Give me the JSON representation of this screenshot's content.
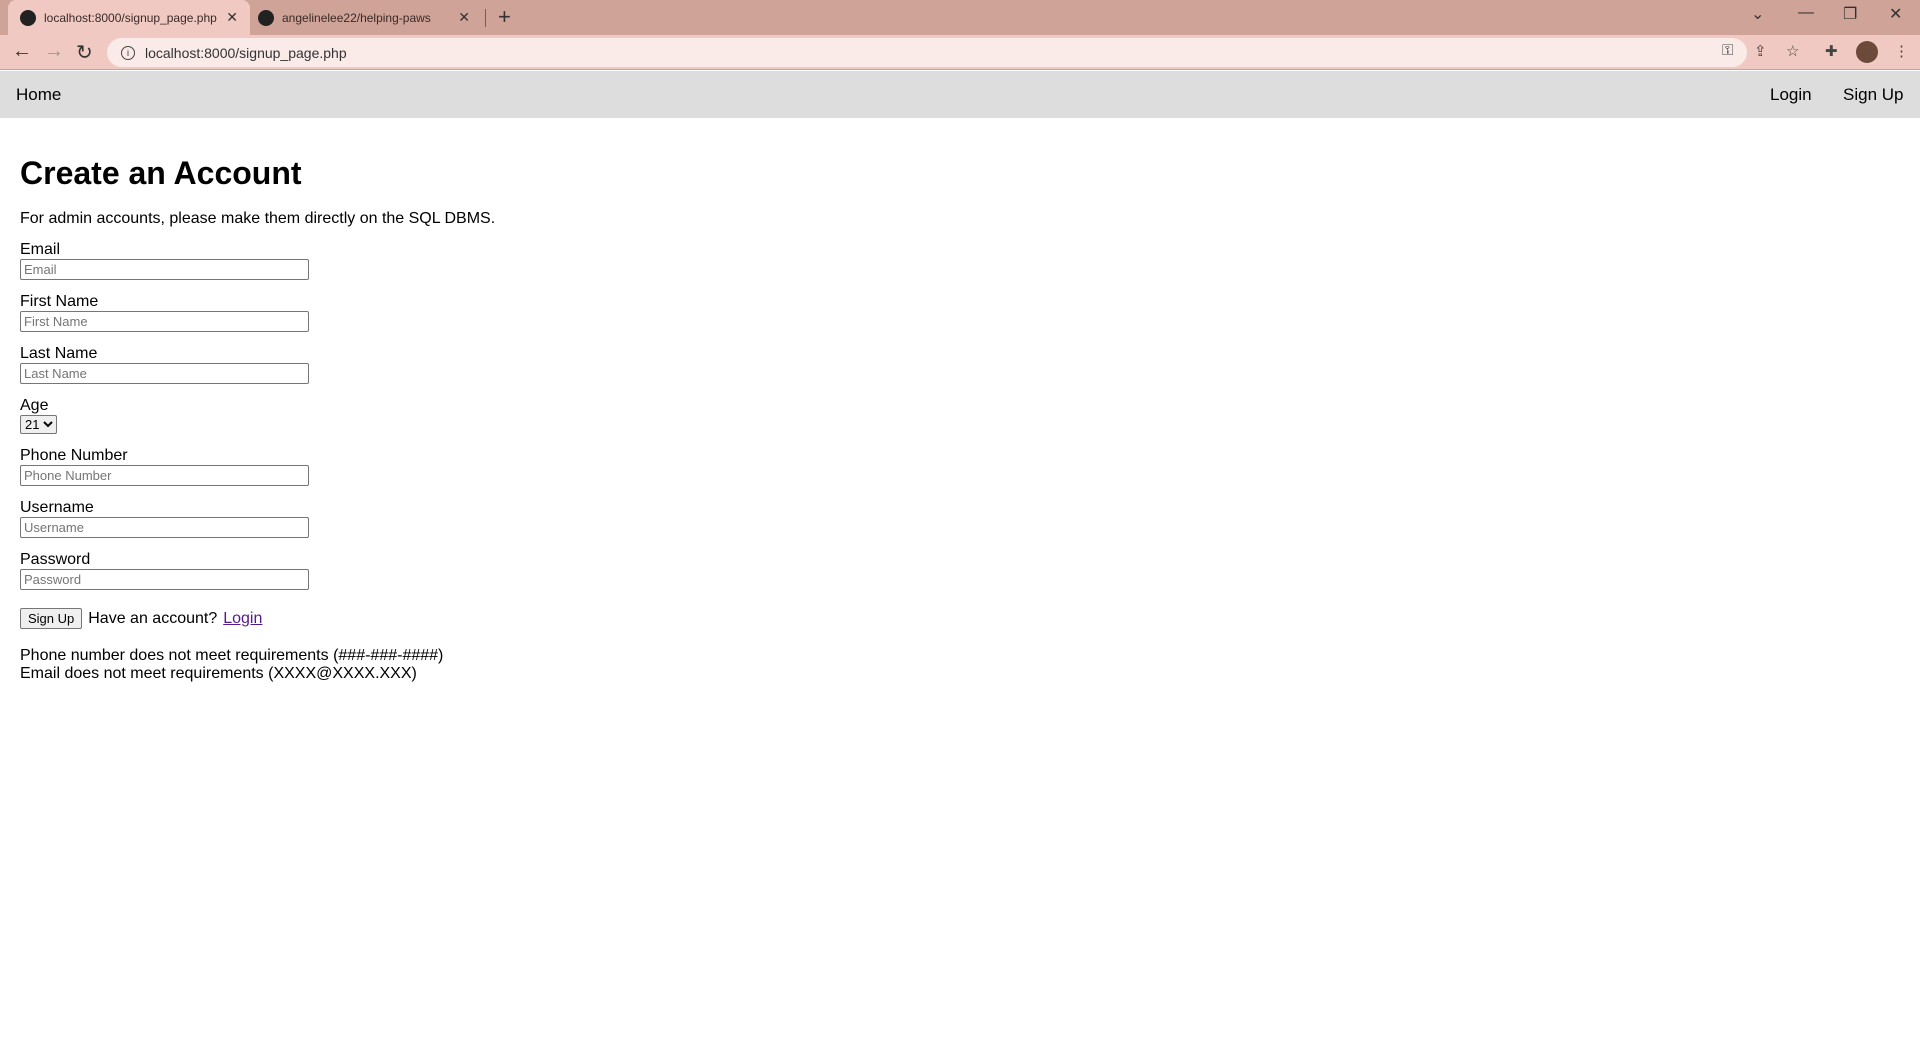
{
  "browser": {
    "tabs": [
      {
        "title": "localhost:8000/signup_page.php",
        "icon": "globe-icon",
        "active": true
      },
      {
        "title": "angelinelee22/helping-paws",
        "icon": "github-icon",
        "active": false
      }
    ],
    "url": "localhost:8000/signup_page.php",
    "theme": {
      "tabbar": "#cfa398",
      "toolbar": "#f0c9c2",
      "omnibox": "#faebe9"
    }
  },
  "nav": {
    "home": "Home",
    "login": "Login",
    "signup": "Sign Up"
  },
  "page": {
    "title": "Create an Account",
    "note": "For admin accounts, please make them directly on the SQL DBMS.",
    "fields": {
      "email": {
        "label": "Email",
        "placeholder": "Email",
        "value": ""
      },
      "first_name": {
        "label": "First Name",
        "placeholder": "First Name",
        "value": ""
      },
      "last_name": {
        "label": "Last Name",
        "placeholder": "Last Name",
        "value": ""
      },
      "age": {
        "label": "Age",
        "selected": "21"
      },
      "phone": {
        "label": "Phone Number",
        "placeholder": "Phone Number",
        "value": ""
      },
      "username": {
        "label": "Username",
        "placeholder": "Username",
        "value": ""
      },
      "password": {
        "label": "Password",
        "placeholder": "Password",
        "value": ""
      }
    },
    "submit": "Sign Up",
    "have_account": "Have an account?",
    "login_link": "Login",
    "errors": [
      "Phone number does not meet requirements (###-###-####)",
      "Email does not meet requirements (XXXX@XXXX.XXX)"
    ]
  }
}
